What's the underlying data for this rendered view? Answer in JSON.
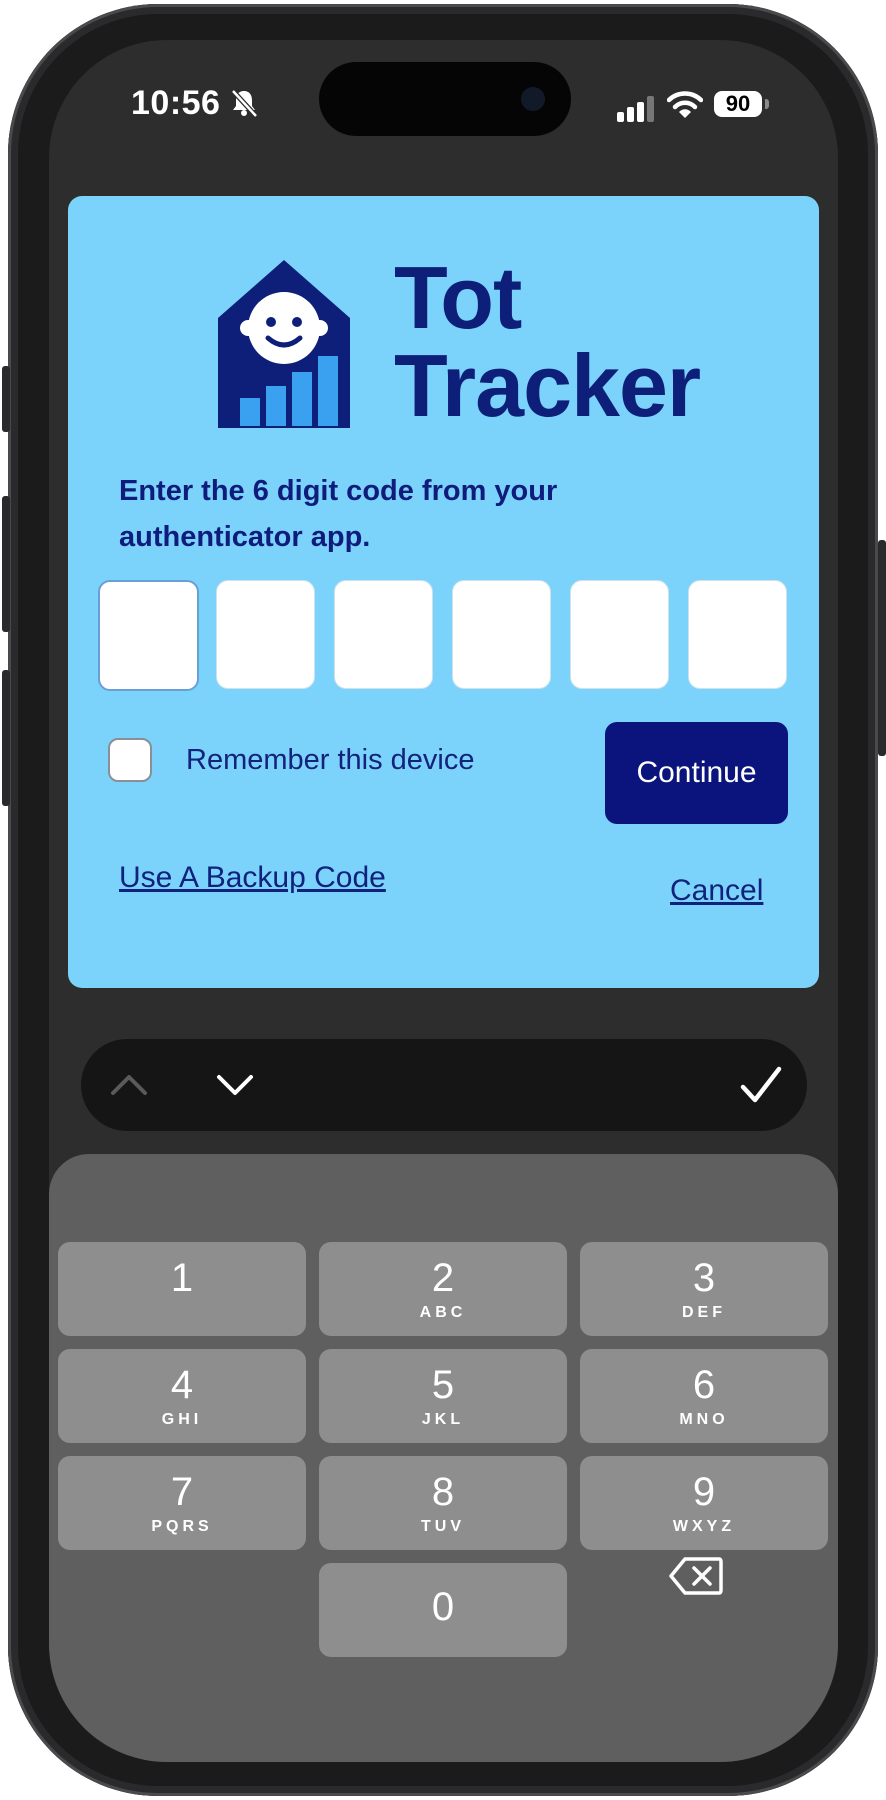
{
  "status_bar": {
    "time": "10:56",
    "battery": "90"
  },
  "app": {
    "brand_line1": "Tot",
    "brand_line2": "Tracker",
    "instruction": "Enter the 6 digit code from your authenticator app.",
    "code_digits": [
      "",
      "",
      "",
      "",
      "",
      ""
    ],
    "remember_label": "Remember this device",
    "remember_checked": false,
    "continue_label": "Continue",
    "backup_link": "Use A Backup Code",
    "cancel_link": "Cancel"
  },
  "keypad": {
    "keys": [
      {
        "num": "1",
        "letters": ""
      },
      {
        "num": "2",
        "letters": "ABC"
      },
      {
        "num": "3",
        "letters": "DEF"
      },
      {
        "num": "4",
        "letters": "GHI"
      },
      {
        "num": "5",
        "letters": "JKL"
      },
      {
        "num": "6",
        "letters": "MNO"
      },
      {
        "num": "7",
        "letters": "PQRS"
      },
      {
        "num": "8",
        "letters": "TUV"
      },
      {
        "num": "9",
        "letters": "WXYZ"
      },
      {
        "num": "0",
        "letters": ""
      }
    ]
  },
  "colors": {
    "card_bg": "#7bd3fb",
    "brand_navy": "#0e1f7a",
    "button_bg": "#0b147c",
    "logo_bars": "#3aa0f0"
  },
  "icons": {
    "bell": "bell-slash-icon",
    "signal": "cellular-signal-icon",
    "wifi": "wifi-icon",
    "prev": "chevron-up-icon",
    "next": "chevron-down-icon",
    "done": "checkmark-icon",
    "delete": "backspace-icon"
  }
}
